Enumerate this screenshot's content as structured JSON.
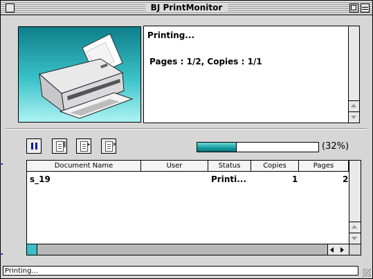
{
  "window": {
    "title": "BJ PrintMonitor"
  },
  "status": {
    "line1": "Printing...",
    "line2": "Pages : 1/2, Copies : 1/1"
  },
  "progress": {
    "fraction": 0.32,
    "label": "(32%)",
    "color": "#1aa4aa"
  },
  "toolbar": {
    "buttons": [
      "pause-icon",
      "hold-icon",
      "resume-icon",
      "cancel-icon"
    ],
    "accent": "#0019b0"
  },
  "table": {
    "columns": [
      "Document Name",
      "User",
      "Status",
      "Copies",
      "Pages"
    ],
    "rows": [
      {
        "document": "s_19",
        "user": "",
        "status": "Printi...",
        "copies": "1",
        "pages": "2"
      }
    ]
  },
  "statusbar": {
    "text": "Printing..."
  }
}
